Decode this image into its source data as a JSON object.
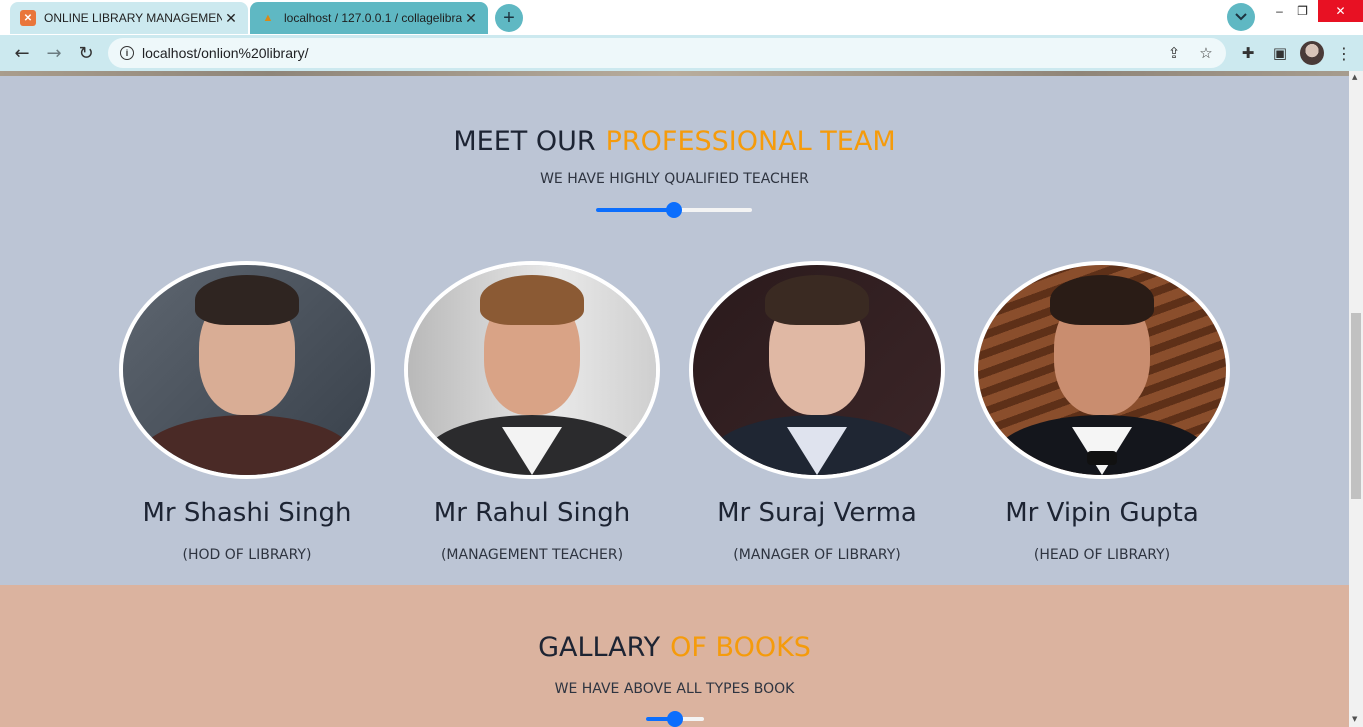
{
  "browser": {
    "tabs": [
      {
        "title": "ONLINE LIBRARY MANAGEMENT",
        "active": true,
        "icon": "xampp-icon"
      },
      {
        "title": "localhost / 127.0.0.1 / collagelibra",
        "active": false,
        "icon": "phpmyadmin-icon"
      }
    ],
    "new_tab_label": "+",
    "address_bar": {
      "url": "localhost/onlion%20library/"
    },
    "icons": {
      "back": "←",
      "forward": "→",
      "reload": "↻",
      "info": "i",
      "share": "⇪",
      "star": "☆",
      "extensions": "✚",
      "sidepanel": "▣",
      "menu": "⋮",
      "tab_search": "⌄",
      "close": "✕",
      "minimize": "–",
      "restore": "❐",
      "window_close": "✕"
    },
    "colors": {
      "active_tab": "#cce9ef",
      "inactive_tab": "#5fb8c3",
      "toolbar": "#cce9ef"
    }
  },
  "team_section": {
    "title_main": "MEET OUR",
    "title_accent": "PROFESSIONAL TEAM",
    "subtitle": "WE HAVE HIGHLY QUALIFIED TEACHER",
    "slider_value": 0.5,
    "colors": {
      "background": "#bcc5d5",
      "accent": "#f59b0b",
      "slider": "#0b6efd"
    },
    "members": [
      {
        "name": "Mr Shashi Singh",
        "role": "(HOD OF LIBRARY)"
      },
      {
        "name": "Mr Rahul Singh",
        "role": "(MANAGEMENT TEACHER)"
      },
      {
        "name": "Mr Suraj Verma",
        "role": "(MANAGER OF LIBRARY)"
      },
      {
        "name": "Mr Vipin Gupta",
        "role": "(HEAD OF LIBRARY)"
      }
    ]
  },
  "gallery_section": {
    "title_main": "GALLARY",
    "title_accent": "OF BOOKS",
    "subtitle": "WE HAVE ABOVE ALL TYPES BOOK",
    "slider_value": 0.5,
    "colors": {
      "background": "#dbb39f"
    }
  }
}
